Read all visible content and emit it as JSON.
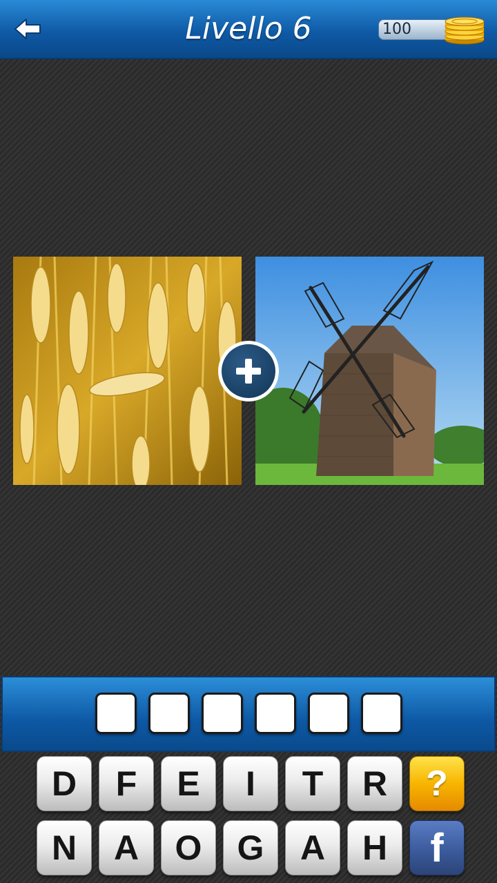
{
  "header": {
    "title": "Livello 6",
    "coins": "100",
    "back_icon": "arrow-left-icon",
    "coins_icon": "gold-coins-icon",
    "bar_color": "#0f5aa6"
  },
  "puzzle": {
    "plus_icon": "plus-icon",
    "left_image": "wheat-field",
    "right_image": "wooden-windmill"
  },
  "answer": {
    "slots": [
      "",
      "",
      "",
      "",
      "",
      ""
    ]
  },
  "keyboard": {
    "row1": [
      "D",
      "F",
      "E",
      "I",
      "T",
      "R"
    ],
    "row2": [
      "N",
      "A",
      "O",
      "G",
      "A",
      "H"
    ],
    "help_label": "?",
    "facebook_label": "f",
    "help_color": "#f7b500",
    "facebook_color": "#3b5b9c"
  }
}
